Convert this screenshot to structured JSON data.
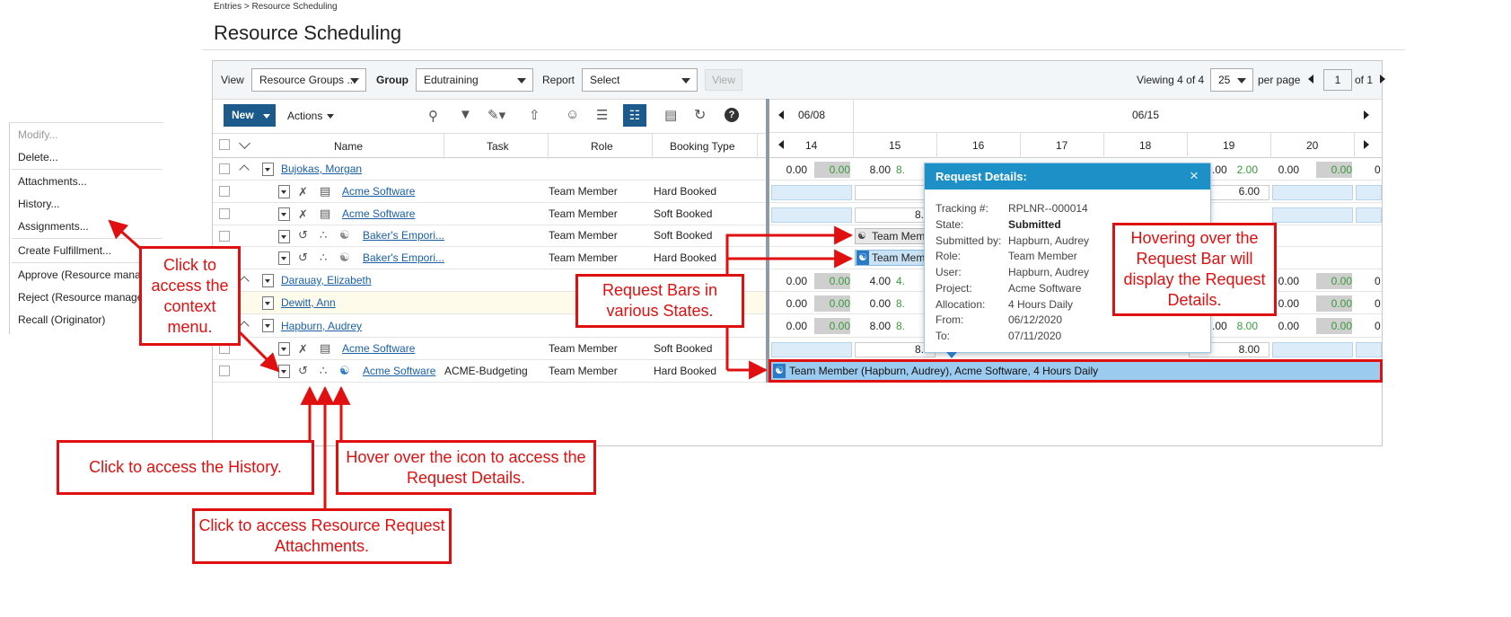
{
  "breadcrumb": "Entries > Resource Scheduling",
  "page_title": "Resource Scheduling",
  "filters": {
    "view_label": "View",
    "view_value": "Resource Groups ...",
    "group_label": "Group",
    "group_value": "Edutraining",
    "report_label": "Report",
    "report_value": "Select",
    "view_button": "View",
    "viewing": "Viewing 4 of 4",
    "per_page_value": "25",
    "per_page_label": "per page",
    "page_value": "1",
    "of_pages": "of 1"
  },
  "toolbar": {
    "new_label": "New",
    "actions_label": "Actions"
  },
  "columns": {
    "name": "Name",
    "task": "Task",
    "role": "Role",
    "booking": "Booking Type"
  },
  "timeline": {
    "week1": "06/08",
    "week2": "06/15",
    "days": [
      "14",
      "15",
      "16",
      "17",
      "18",
      "19",
      "20"
    ]
  },
  "rows": [
    {
      "name": "Bujokas, Morgan",
      "task": "",
      "role": "",
      "booking": ""
    },
    {
      "name": "Acme Software",
      "task": "",
      "role": "Team Member",
      "booking": "Hard Booked"
    },
    {
      "name": "Acme Software",
      "task": "",
      "role": "Team Member",
      "booking": "Soft Booked"
    },
    {
      "name": "Baker's Empori...",
      "task": "",
      "role": "Team Member",
      "booking": "Soft Booked"
    },
    {
      "name": "Baker's Empori...",
      "task": "",
      "role": "Team Member",
      "booking": "Hard Booked"
    },
    {
      "name": "Darauay, Elizabeth",
      "task": "",
      "role": "",
      "booking": ""
    },
    {
      "name": "Dewitt, Ann",
      "task": "",
      "role": "",
      "booking": ""
    },
    {
      "name": "Hapburn, Audrey",
      "task": "",
      "role": "",
      "booking": ""
    },
    {
      "name": "Acme Software",
      "task": "",
      "role": "Team Member",
      "booking": "Soft Booked"
    },
    {
      "name": "Acme Software",
      "task": "ACME-Budgeting",
      "role": "Team Member",
      "booking": "Hard Booked"
    }
  ],
  "grid_values": {
    "r0": [
      "0.00",
      "0.00",
      "8.00",
      "8.",
      ".00",
      "2.00",
      "0.00",
      "0.00",
      "0"
    ],
    "r1": [
      "6.00"
    ],
    "r2": [
      "8."
    ],
    "r5": [
      "0.00",
      "0.00",
      "4.00",
      "4.",
      "0.00",
      "0.00",
      "0"
    ],
    "r6": [
      "0.00",
      "0.00",
      "0.00",
      "8.",
      "0.00",
      "0.00",
      "0"
    ],
    "r7": [
      "0.00",
      "0.00",
      "8.00",
      "8.",
      ".00",
      "8.00",
      "0.00",
      "0.00",
      "0"
    ],
    "r8": [
      "8.",
      "8.00"
    ]
  },
  "bars": {
    "bar1": "Team Mem",
    "bar2": "Team Mem",
    "bar3": "Team Member (Hapburn, Audrey), Acme Software, 4 Hours Daily"
  },
  "context_menu": [
    "Modify...",
    "Delete...",
    "Attachments...",
    "History...",
    "Assignments...",
    "Create Fulfillment...",
    "Approve (Resource manag",
    "Reject (Resource manager",
    "Recall (Originator)"
  ],
  "tooltip": {
    "title": "Request Details:",
    "fields": [
      {
        "k": "Tracking #:",
        "v": "RPLNR--000014"
      },
      {
        "k": "State:",
        "v": "Submitted"
      },
      {
        "k": "Submitted by:",
        "v": "Hapburn, Audrey"
      },
      {
        "k": "Role:",
        "v": "Team Member"
      },
      {
        "k": "User:",
        "v": "Hapburn, Audrey"
      },
      {
        "k": "Project:",
        "v": "Acme Software"
      },
      {
        "k": "Allocation:",
        "v": "4 Hours Daily"
      },
      {
        "k": "From:",
        "v": "06/12/2020"
      },
      {
        "k": "To:",
        "v": "07/11/2020"
      }
    ]
  },
  "callouts": {
    "context": "Click to access the context menu.",
    "bars": "Request Bars in various States.",
    "hover": "Hovering over the Request Bar will display the Request Details.",
    "history": "Click to access the History.",
    "icon": "Hover over the icon to access the Request Details.",
    "attach": "Click to access Resource Request Attachments."
  },
  "colors": {
    "accent": "#1b5a8a",
    "annotation": "#e01010",
    "tooltip_header": "#1e90c8",
    "bar": "#9ccbf0"
  }
}
